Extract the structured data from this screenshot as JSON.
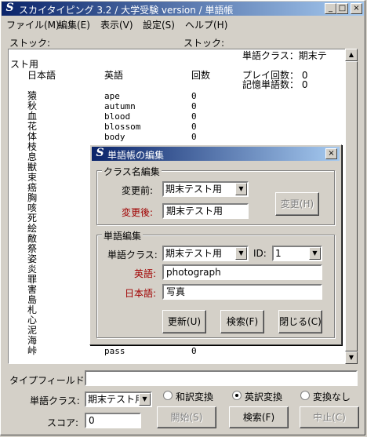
{
  "window": {
    "title": "スカイタイピング 3.2 / 大学受験 version / 単語帳"
  },
  "window_buttons": {
    "minimize": "_",
    "maximize": "□",
    "close": "×"
  },
  "menu": [
    "ファイル(M)",
    "編集(E)",
    "表示(V)",
    "設定(S)",
    "ヘルプ(H)"
  ],
  "stock_left_label": "ストック:",
  "stock_right_label": "ストック:",
  "stock_list": {
    "class_label": "単語クラス：期末テ",
    "list_heading": "スト用",
    "headers": {
      "jp": "日本語",
      "en": "英語",
      "count": "回数"
    },
    "play_count": "プレイ回数： 0",
    "memorized": "記憶単語数： 0",
    "rows": [
      {
        "jp": "猿",
        "en": "ape",
        "count": "0"
      },
      {
        "jp": "秋",
        "en": "autumn",
        "count": "0"
      },
      {
        "jp": "血",
        "en": "blood",
        "count": "0"
      },
      {
        "jp": "花",
        "en": "blossom",
        "count": "0"
      },
      {
        "jp": "体",
        "en": "body",
        "count": "0"
      },
      {
        "jp": "枝",
        "en": "",
        "count": ""
      },
      {
        "jp": "息",
        "en": "",
        "count": ""
      },
      {
        "jp": "獣",
        "en": "",
        "count": ""
      },
      {
        "jp": "束",
        "en": "",
        "count": ""
      },
      {
        "jp": "癌",
        "en": "",
        "count": ""
      },
      {
        "jp": "胸",
        "en": "",
        "count": ""
      },
      {
        "jp": "咳",
        "en": "",
        "count": ""
      },
      {
        "jp": "死",
        "en": "",
        "count": ""
      },
      {
        "jp": "絵",
        "en": "",
        "count": ""
      },
      {
        "jp": "敵",
        "en": "",
        "count": ""
      },
      {
        "jp": "祭",
        "en": "",
        "count": ""
      },
      {
        "jp": "姿",
        "en": "",
        "count": ""
      },
      {
        "jp": "炎",
        "en": "",
        "count": ""
      },
      {
        "jp": "罪",
        "en": "",
        "count": ""
      },
      {
        "jp": "害",
        "en": "",
        "count": ""
      },
      {
        "jp": "島",
        "en": "",
        "count": ""
      },
      {
        "jp": "札",
        "en": "",
        "count": ""
      },
      {
        "jp": "心",
        "en": "",
        "count": ""
      },
      {
        "jp": "泥",
        "en": "",
        "count": ""
      },
      {
        "jp": "海",
        "en": "",
        "count": ""
      },
      {
        "jp": "峠",
        "en": "pass",
        "count": "0"
      }
    ]
  },
  "bottom": {
    "type_field_label": "タイプフィールド:",
    "type_field_value": "",
    "class_label": "単語クラス:",
    "class_value": "期末テスト用",
    "radios": [
      {
        "label": "和訳変換",
        "selected": false
      },
      {
        "label": "英訳変換",
        "selected": true
      },
      {
        "label": "変換なし",
        "selected": false
      }
    ],
    "score_label": "スコア:",
    "score_value": "0",
    "start_button": "開始(S)",
    "search_button": "検索(F)",
    "stop_button": "中止(C)"
  },
  "dialog": {
    "title": "単語帳の編集",
    "close": "×",
    "class_group": {
      "title": "クラス名編集",
      "before_label": "変更前:",
      "before_value": "期末テスト用",
      "after_label": "変更後:",
      "after_value": "期末テスト用",
      "change_button": "変更(H)"
    },
    "word_group": {
      "title": "単語編集",
      "class_label": "単語クラス:",
      "class_value": "期末テスト用",
      "id_label": "ID:",
      "id_value": "1",
      "en_label": "英語:",
      "en_value": "photograph",
      "jp_label": "日本語:",
      "jp_value": "写真"
    },
    "update_button": "更新(U)",
    "search_button": "検索(F)",
    "close_button": "閉じる(C)"
  },
  "colors": {
    "title_start": "#0a246a",
    "title_end": "#a6caf0",
    "required_label": "#a00000",
    "face": "#d4d0c8"
  }
}
